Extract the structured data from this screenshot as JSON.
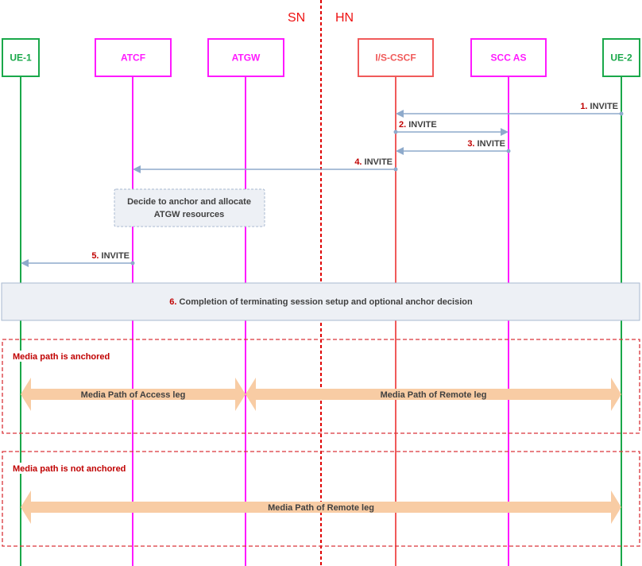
{
  "domains": {
    "left": "SN",
    "right": "HN"
  },
  "entities": [
    {
      "id": "ue1",
      "label": "UE-1",
      "color": "#1aa84a"
    },
    {
      "id": "atcf",
      "label": "ATCF",
      "color": "#ff1aff"
    },
    {
      "id": "atgw",
      "label": "ATGW",
      "color": "#ff1aff"
    },
    {
      "id": "cscf",
      "label": "I/S-CSCF",
      "color": "#f05a5a"
    },
    {
      "id": "sccas",
      "label": "SCC AS",
      "color": "#ff1aff"
    },
    {
      "id": "ue2",
      "label": "UE-2",
      "color": "#1aa84a"
    }
  ],
  "messages": [
    {
      "num": "1.",
      "label": "INVITE",
      "from": "ue2",
      "to": "cscf"
    },
    {
      "num": "2.",
      "label": "INVITE",
      "from": "cscf",
      "to": "sccas"
    },
    {
      "num": "3.",
      "label": "INVITE",
      "from": "sccas",
      "to": "cscf"
    },
    {
      "num": "4.",
      "label": "INVITE",
      "from": "cscf",
      "to": "atcf"
    },
    {
      "num": "5.",
      "label": "INVITE",
      "from": "atcf",
      "to": "ue1"
    }
  ],
  "note": {
    "lines": [
      "Decide to anchor and allocate",
      "ATGW resources"
    ]
  },
  "step6": {
    "num": "6.",
    "label": "Completion of terminating session setup and optional anchor decision"
  },
  "groups": [
    {
      "title": "Media path is anchored",
      "paths": [
        {
          "label": "Media Path of Access leg",
          "from": "ue1",
          "to": "atgw"
        },
        {
          "label": "Media Path of Remote leg",
          "from": "atgw",
          "to": "ue2"
        }
      ]
    },
    {
      "title": "Media path is not anchored",
      "paths": [
        {
          "label": "Media Path of Remote leg",
          "from": "ue1",
          "to": "ue2"
        }
      ]
    }
  ],
  "colors": {
    "arrow": "#8eaacb",
    "media": "#f8cca4",
    "divider": "#e00000",
    "group": "#d9343a",
    "noteFill": "#edf0f5"
  }
}
